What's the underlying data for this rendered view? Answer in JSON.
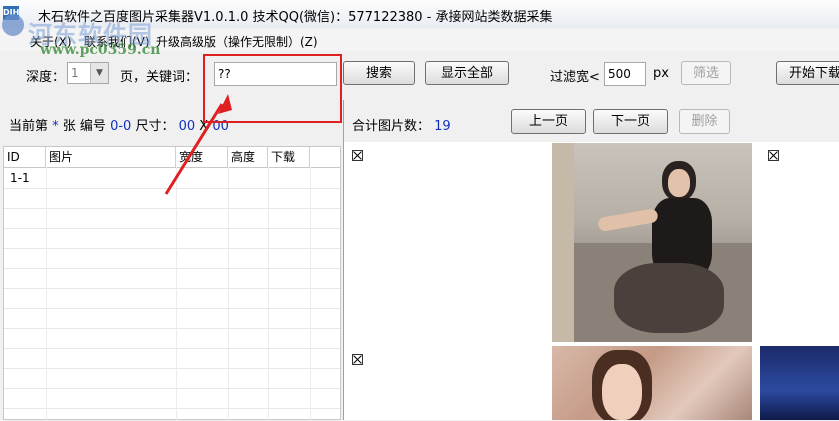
{
  "window": {
    "title": "木石软件之百度图片采集器V1.0.1.0  技术QQ(微信)：577122380  - 承接网站类数据采集",
    "icon": "app-icon",
    "icon_text": "DIH"
  },
  "watermark": {
    "text": "河东软件园",
    "url": "www.pc0359.cn"
  },
  "menu": [
    {
      "label": "关于(X)"
    },
    {
      "label": "联系我们(V)"
    },
    {
      "label": "升级高级版（操作无限制）(Z)"
    }
  ],
  "toolbar": {
    "depth_label": "深度：",
    "depth_value": "1",
    "page_keyword_label": "页，关键词：",
    "keyword_value": "??",
    "search_label": "搜索",
    "show_all_label": "显示全部",
    "filter_width_label": "过滤宽<",
    "filter_width_value": "500",
    "px_label": "px",
    "filter_button_label": "筛选",
    "start_download_label": "开始下载"
  },
  "left_header": {
    "current_label": "当前第",
    "current_value": "*",
    "unit_label": "张 编号",
    "number_value": "0-0",
    "size_label": "尺寸：",
    "width_value": "00",
    "x_label": "X",
    "height_value": "00"
  },
  "right_header": {
    "total_label": "合计图片数：",
    "total_value": "19",
    "prev_label": "上一页",
    "next_label": "下一页",
    "delete_label": "删除"
  },
  "table": {
    "columns": [
      "ID",
      "图片",
      "宽度",
      "高度",
      "下载"
    ],
    "rows": [
      {
        "id": "1-1"
      }
    ]
  },
  "colors": {
    "accent_blue": "#1030c0",
    "annotation_red": "#e02020"
  }
}
